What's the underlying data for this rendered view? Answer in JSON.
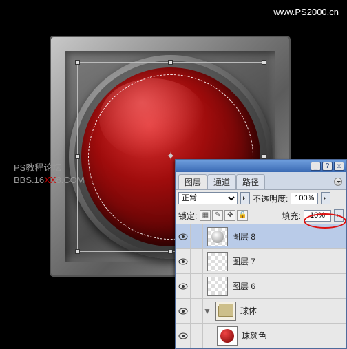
{
  "watermark": {
    "url": "www.PS2000.cn",
    "forum_line1": "PS教程论坛",
    "forum_line2_a": "BBS.16",
    "forum_line2_b": "XX",
    "forum_line2_c": "8.COM"
  },
  "titlebar": {
    "min": "_",
    "help": "?",
    "close": "x"
  },
  "tabs": {
    "layers": "图层",
    "channels": "通道",
    "paths": "路径"
  },
  "blend": {
    "mode": "正常",
    "opacity_label": "不透明度:",
    "opacity_value": "100%"
  },
  "lock": {
    "label": "锁定:",
    "fill_label": "填充:",
    "fill_value": "10%",
    "icons": {
      "pix": "▦",
      "brush": "✎",
      "move": "✥",
      "all": "🔒"
    }
  },
  "layers": [
    {
      "name": "图层 8",
      "selected": true,
      "thumb": "mask"
    },
    {
      "name": "图层 7",
      "selected": false,
      "thumb": "checker"
    },
    {
      "name": "图层 6",
      "selected": false,
      "thumb": "checker"
    },
    {
      "name": "球体",
      "selected": false,
      "thumb": "group",
      "group": true
    },
    {
      "name": "球颜色",
      "selected": false,
      "thumb": "red"
    }
  ],
  "twisty": "▼"
}
